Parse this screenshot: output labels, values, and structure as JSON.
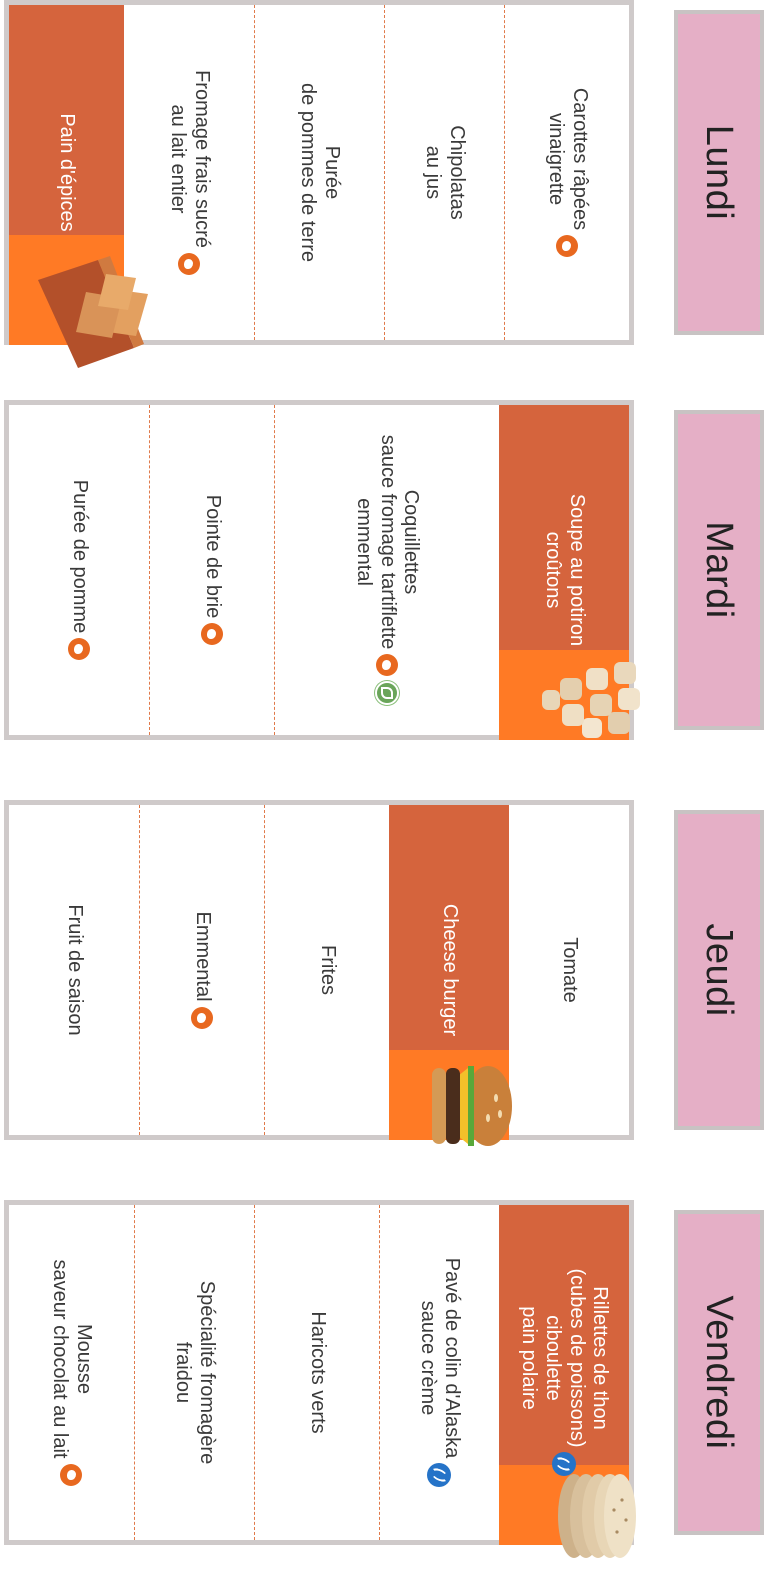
{
  "days": [
    {
      "name": "Lundi",
      "items": [
        {
          "label": "Carottes râpées\nvinaigrette",
          "icon": "local-icon"
        },
        {
          "label": "Chipolatas\nau jus"
        },
        {
          "label": "Purée\nde pommes de terre"
        },
        {
          "label": "Fromage frais sucré\nau lait entier",
          "icon": "local-icon"
        },
        {
          "label": "Pain d'épices",
          "highlight": true,
          "image": "gingerbread-image"
        }
      ]
    },
    {
      "name": "Mardi",
      "items": [
        {
          "label": "Soupe au potiron\ncroûtons",
          "highlight": true,
          "image": "croutons-image"
        },
        {
          "label": "Coquillettes\nsauce fromage tartiflette\nemmental",
          "icon": "local-icon",
          "icon2": "organic-icon"
        },
        {
          "label": "Pointe de brie",
          "icon": "local-icon"
        },
        {
          "label": "Purée de pomme",
          "icon": "local-icon"
        }
      ]
    },
    {
      "name": "Jeudi",
      "items": [
        {
          "label": "Tomate"
        },
        {
          "label": "Cheese burger",
          "highlight": true,
          "image": "burger-image"
        },
        {
          "label": "Frites"
        },
        {
          "label": "Emmental",
          "icon": "local-icon"
        },
        {
          "label": "Fruit de saison"
        }
      ]
    },
    {
      "name": "Vendredi",
      "items": [
        {
          "label": "Rillettes de thon\n(cubes de poissons)\nciboulette\npain polaire",
          "highlight": true,
          "icon": "fish-icon",
          "image": "flatbread-image"
        },
        {
          "label": "Pavé de colin d'Alaska\nsauce crème",
          "icon": "fish-icon"
        },
        {
          "label": "Haricots verts"
        },
        {
          "label": "Spécialité fromagère\nfraidou"
        },
        {
          "label": "Mousse\nsaveur chocolat au lait",
          "icon": "local-icon"
        }
      ]
    }
  ],
  "colors": {
    "header_bg": "#e5afc6",
    "highlight_bg": "#d5643d",
    "highlight_accent": "#ff7a25",
    "dash": "#e07a4a",
    "border": "#cfcaca"
  }
}
